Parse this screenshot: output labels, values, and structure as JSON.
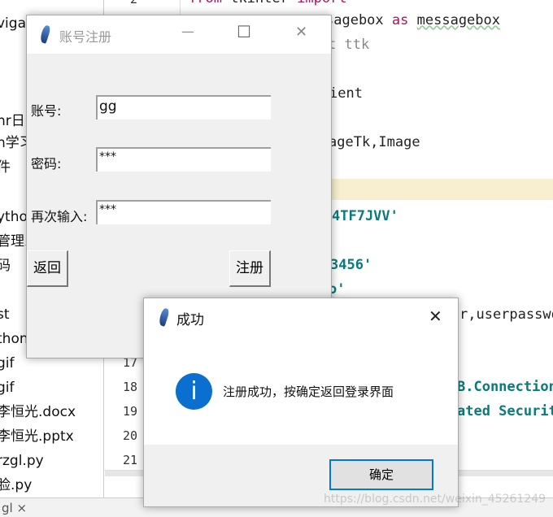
{
  "file_list": [
    "viga",
    "nr日",
    "n学习",
    "件",
    "ytho",
    "管理系",
    "码",
    "st",
    "thon",
    "gif",
    "gif",
    "李恒光.docx",
    "李恒光.pptx",
    "rzgl.py",
    "脸.py"
  ],
  "bottom_tab": "gl ×",
  "line_numbers": [
    "2",
    "17",
    "18",
    "19",
    "20",
    "21"
  ],
  "code_lines": {
    "l2_a": "from",
    "l2_b": "tkinter",
    "l2_c": "import",
    "l3_a": "sagebox",
    "l3_b": "as",
    "l3_c": "messagebox",
    "l4": "t ttk",
    "l6": "ient",
    "l8": "ageTk,Image",
    "l10": "4TF7JVV'",
    "l12": "3456'",
    "l13": "o'",
    "l15": "r,userpasswo",
    "l18": "B.Connection",
    "l19": "ated Securit"
  },
  "register_window": {
    "title": "账号注册",
    "minimize": "—",
    "maximize": "☐",
    "close": "✕",
    "account_label": "账号:",
    "account_value": "gg",
    "password_label": "密码:",
    "password_value": "***",
    "confirm_label": "再次输入:",
    "confirm_value": "***",
    "back_button": "返回",
    "register_button": "注册"
  },
  "message_box": {
    "title": "成功",
    "close": "✕",
    "icon": "info-icon",
    "icon_glyph": "i",
    "message": "注册成功，按确定返回登录界面",
    "ok_button": "确定",
    "accent": "#0078d7"
  },
  "watermark": "https://blog.csdn.net/weixin_45261249"
}
